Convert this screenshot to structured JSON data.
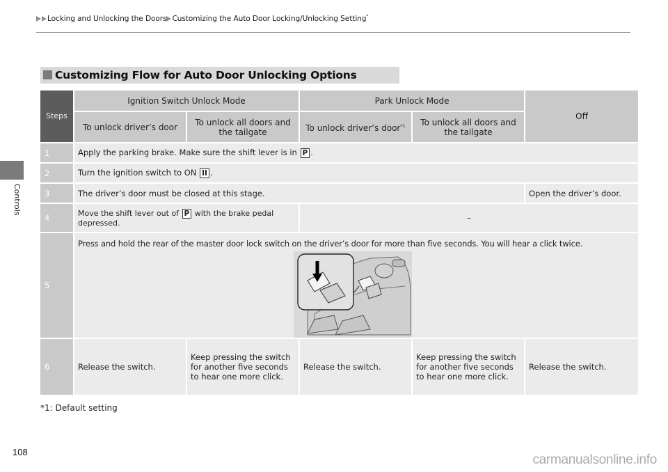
{
  "breadcrumb": {
    "items": [
      "Locking and Unlocking the Doors",
      "Customizing the Auto Door Locking/Unlocking Setting"
    ],
    "suffix_mark": "*"
  },
  "side": {
    "label": "Controls"
  },
  "section": {
    "title": "Customizing Flow for Auto Door Unlocking Options"
  },
  "table": {
    "steps_header": "Steps",
    "groups": [
      "Ignition Switch Unlock Mode",
      "Park Unlock Mode",
      "Off"
    ],
    "subheaders": [
      "To unlock driver’s door",
      "To unlock all doors and the tailgate",
      "To unlock driver’s door",
      "To unlock all doors and the tailgate"
    ],
    "default_marker": "*1",
    "rows": [
      {
        "step": "1",
        "text_before": "Apply the parking brake. Make sure the shift lever is in ",
        "key": "P",
        "text_after": "."
      },
      {
        "step": "2",
        "text_before": "Turn the ignition switch to ON ",
        "key": "II",
        "text_after": "."
      },
      {
        "step": "3",
        "text": "The driver’s door must be closed at this stage.",
        "off_text": "Open the driver’s door."
      },
      {
        "step": "4",
        "text_before": "Move the shift lever out of ",
        "key": "P",
        "text_after": " with the brake pedal depressed.",
        "rest_text": "–"
      },
      {
        "step": "5",
        "text": "Press and hold the rear of the master door lock switch on the driver’s door for more than five seconds. You will hear a click twice."
      },
      {
        "step": "6",
        "cells": [
          "Release the switch.",
          "Keep pressing the switch for another five seconds to hear one more click.",
          "Release the switch.",
          "Keep pressing the switch for another five seconds to hear one more click.",
          "Release the switch."
        ]
      }
    ]
  },
  "footnote": "*1: Default setting",
  "page_number": "108",
  "watermark": "carmanualsonline.info"
}
